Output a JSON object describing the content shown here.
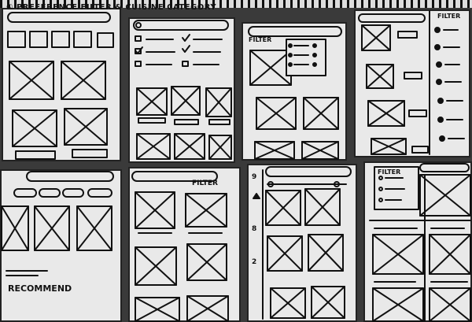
{
  "sketch": {
    "heading": "① PREFERENCE FILTER & CUISINE CATEGORY",
    "labels": {
      "filter_1": "FILTER",
      "filter_2": "FILTER",
      "filter_3": "FILTER",
      "filter_4": "FILTER",
      "recommend": "RECOMMEND",
      "margin_numbers": [
        "9",
        "8",
        "2"
      ]
    }
  }
}
